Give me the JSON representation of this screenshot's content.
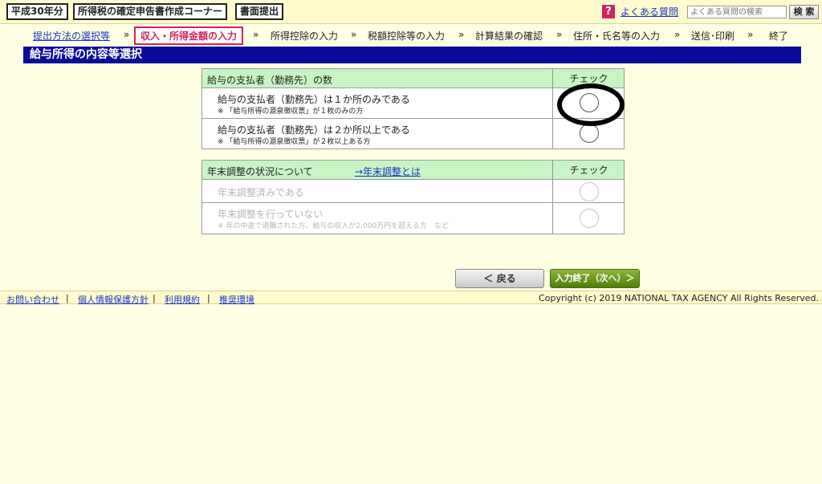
{
  "header": {
    "era_year": "平成30年分",
    "corner_title": "所得税の確定申告書作成コーナー",
    "submit_doc": "書面提出",
    "faq_icon_char": "?",
    "faq_label": "よくある質問",
    "search_placeholder": "よくある質問の検索",
    "search_button": "検 索"
  },
  "steps": [
    {
      "label": "提出方法の選択等",
      "state": "link"
    },
    {
      "label": "収入・所得金額の入力",
      "state": "current"
    },
    {
      "label": "所得控除の入力",
      "state": "upcoming"
    },
    {
      "label": "税額控除等の入力",
      "state": "upcoming"
    },
    {
      "label": "計算結果の確認",
      "state": "upcoming"
    },
    {
      "label": "住所・氏名等の入力",
      "state": "upcoming"
    },
    {
      "label": "送信･印刷",
      "state": "upcoming"
    },
    {
      "label": "終了",
      "state": "upcoming"
    }
  ],
  "step_arrow": "»",
  "page_title": "給与所得の内容等選択",
  "payer_table": {
    "header": "給与の支払者（勤務先）の数",
    "check_header": "チェック",
    "rows": [
      {
        "main": "給与の支払者（勤務先）は１か所のみである",
        "note": "※ 「給与所得の源泉徴収票」が１枚のみの方"
      },
      {
        "main": "給与の支払者（勤務先）は２か所以上である",
        "note": "※ 「給与所得の源泉徴収票」が２枚以上ある方"
      }
    ]
  },
  "year_end_table": {
    "header": "年末調整の状況について",
    "link": "→年末調整とは",
    "check_header": "チェック",
    "rows": [
      {
        "main": "年末調整済みである",
        "note": ""
      },
      {
        "main": "年末調整を行っていない",
        "note": "※ 年の中途で退職された方、給与の収入が2,000万円を超える方　など"
      }
    ]
  },
  "buttons": {
    "back": "＜ 戻る",
    "next": "入力終了（次へ）＞"
  },
  "footer": {
    "links": [
      "お問い合わせ",
      "個人情報保護方針",
      "利用規約",
      "推奨環境"
    ],
    "separator": "|",
    "copyright": "Copyright (c) 2019 NATIONAL TAX AGENCY All Rights Reserved."
  },
  "colors": {
    "title_bar": "#0b0d9a",
    "current_step": "#d0245f",
    "table_header": "#c8f5c6",
    "next_button": "#5a8a12",
    "page_bg": "#ffffe4"
  }
}
